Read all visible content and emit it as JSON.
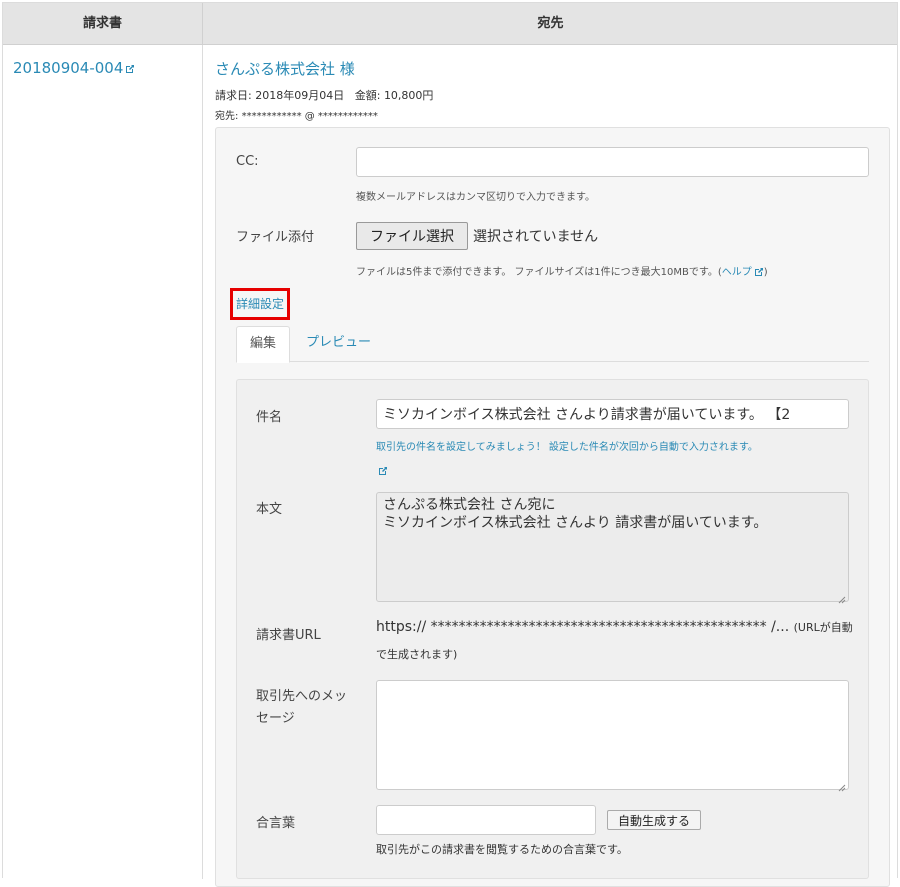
{
  "table": {
    "headers": {
      "invoice": "請求書",
      "destination": "宛先"
    }
  },
  "invoice": {
    "number": "20180904-004"
  },
  "destination": {
    "company": "さんぷる株式会社 様",
    "invoice_date_label": "請求日:",
    "invoice_date": "2018年09月04日",
    "amount_label": "金額:",
    "amount": "10,800円",
    "to_label": "宛先:",
    "to_value": "************ @ ************"
  },
  "form": {
    "cc_label": "CC:",
    "cc_value": "",
    "cc_help": "複数メールアドレスはカンマ区切りで入力できます。",
    "file_label": "ファイル添付",
    "file_button": "ファイル選択",
    "file_status": "選択されていません",
    "file_help": "ファイルは5件まで添付できます。 ファイルサイズは1件につき最大10MBです。(",
    "file_help_link": "ヘルプ",
    "file_help_close": ")",
    "advanced_link": "詳細設定",
    "tabs": [
      {
        "label": "編集",
        "active": true
      },
      {
        "label": "プレビュー",
        "active": false
      }
    ],
    "subject_label": "件名",
    "subject_value": "ミソカインボイス株式会社 さんより請求書が届いています。 【2",
    "subject_help": "取引先の件名を設定してみましょう！ 設定した件名が次回から自動で入力されます。",
    "body_label": "本文",
    "body_line1": "さんぷる株式会社 さん宛に",
    "body_line2": "ミソカインボイス株式会社 さんより 請求書が届いています。",
    "url_label": "請求書URL",
    "url_value": "https:// ************************************************ /...",
    "url_note_1": "(URLが自動",
    "url_note_2": "で生成されます)",
    "message_label_1": "取引先へのメッ",
    "message_label_2": "セージ",
    "message_value": "",
    "password_label": "合言葉",
    "password_value": "",
    "password_button": "自動生成する",
    "password_help": "取引先がこの請求書を閲覧するための合言葉です。"
  },
  "colors": {
    "link": "#2a8ab5",
    "highlight": "#e60000",
    "header_bg": "#e4e4e4"
  },
  "icons": {
    "external_link": "external-link-icon",
    "resize_handle": "resize-handle-icon"
  }
}
